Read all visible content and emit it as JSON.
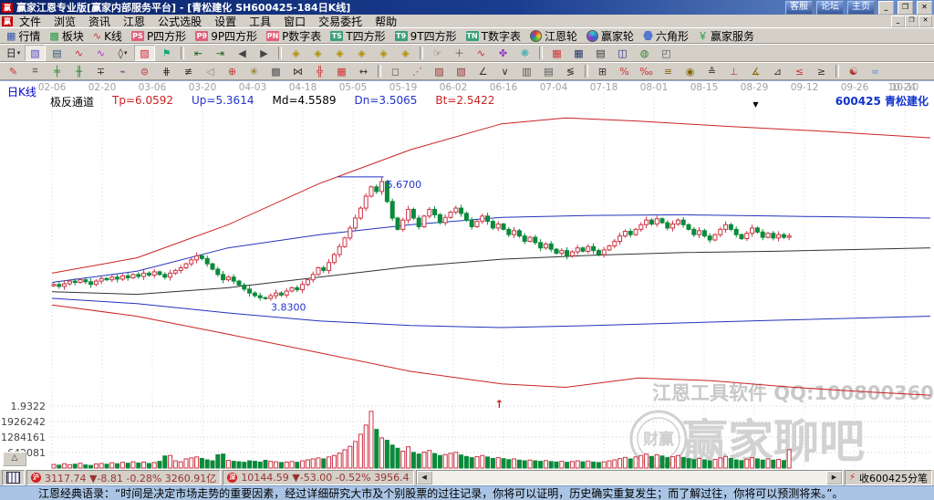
{
  "window": {
    "title": "赢家江恩专业版[赢家内部服务平台] - [青松建化  SH600425-184日K线]",
    "logo_glyph": "赢",
    "title_buttons": [
      "客服",
      "论坛",
      "主页"
    ],
    "win_controls": [
      "_",
      "❐",
      "✕"
    ]
  },
  "menu": {
    "items": [
      "文件",
      "浏览",
      "资讯",
      "江恩",
      "公式选股",
      "设置",
      "工具",
      "窗口",
      "交易委托",
      "帮助"
    ]
  },
  "toolbar_main": {
    "items": [
      {
        "icon": "grid",
        "color": "#3355aa",
        "label": "行情",
        "name": "quotes-button"
      },
      {
        "icon": "blocks",
        "color": "#2a9a4a",
        "label": "板块",
        "name": "sectors-button"
      },
      {
        "icon": "kline",
        "color": "#cc3333",
        "label": "K线",
        "name": "kline-button"
      },
      {
        "badge": "PS",
        "color": "#e0607a",
        "label": "P四方形",
        "name": "p-square-button"
      },
      {
        "badge": "P9",
        "color": "#e0607a",
        "label": "9P四方形",
        "name": "p9-square-button"
      },
      {
        "badge": "PN",
        "color": "#e0607a",
        "label": "P数字表",
        "name": "p-number-table-button"
      },
      {
        "badge": "TS",
        "color": "#3aa07a",
        "label": "T四方形",
        "name": "t-square-button"
      },
      {
        "badge": "T9",
        "color": "#3aa07a",
        "label": "9T四方形",
        "name": "t9-square-button"
      },
      {
        "badge": "TN",
        "color": "#3aa07a",
        "label": "T数字表",
        "name": "t-number-table-button"
      },
      {
        "icon": "wheel",
        "label": "江恩轮",
        "name": "gann-wheel-button"
      },
      {
        "icon": "wheel2",
        "label": "赢家轮",
        "name": "winner-wheel-button"
      },
      {
        "icon": "hex",
        "label": "六角形",
        "name": "hexagon-button"
      },
      {
        "icon": "yen",
        "color": "#2a9a4a",
        "label": "赢家服务",
        "name": "winner-service-button"
      }
    ]
  },
  "toolbar_view": {
    "items": [
      {
        "g": "日",
        "c": "#222",
        "arrow": true,
        "n": "period-day-selector"
      },
      {
        "g": "▧",
        "c": "#5548c8",
        "p": true,
        "n": "chart-style-button"
      },
      {
        "g": "▤",
        "c": "#335577",
        "n": "info-board-button"
      },
      {
        "g": "∿",
        "c": "#cc2233",
        "n": "wave-up-button"
      },
      {
        "g": "∿",
        "c": "#aa33cc",
        "n": "wave-down-button"
      },
      {
        "g": "◊",
        "c": "#333333",
        "arrow": true,
        "n": "candle-width-selector"
      },
      {
        "g": "▨",
        "c": "#cc2233",
        "p": true,
        "n": "main-chart-button"
      },
      {
        "g": "⚑",
        "c": "#11aa77",
        "n": "flag-marker-button"
      },
      {
        "sep": true
      },
      {
        "g": "⇤",
        "c": "#226622",
        "n": "first-bar-button"
      },
      {
        "g": "⇥",
        "c": "#226622",
        "n": "last-bar-button"
      },
      {
        "g": "◀",
        "c": "#444444",
        "n": "prev-bar-button"
      },
      {
        "g": "▶",
        "c": "#444444",
        "n": "next-bar-button"
      },
      {
        "sep": true
      },
      {
        "g": "◈",
        "c": "#b09000",
        "n": "zoom-out-button"
      },
      {
        "g": "◈",
        "c": "#b09000",
        "n": "zoom-in-button"
      },
      {
        "g": "◈",
        "c": "#b09000",
        "n": "expand-x-button"
      },
      {
        "g": "◈",
        "c": "#b09000",
        "n": "shrink-x-button"
      },
      {
        "g": "◈",
        "c": "#b09000",
        "n": "expand-y-button"
      },
      {
        "g": "◈",
        "c": "#b09000",
        "n": "shrink-y-button"
      },
      {
        "sep": true
      },
      {
        "g": "☞",
        "c": "#555555",
        "n": "hand-tool-button"
      },
      {
        "g": "＋",
        "c": "#555555",
        "n": "crosshair-button"
      },
      {
        "g": "∿",
        "c": "#cc2233",
        "n": "zigzag-tool-button"
      },
      {
        "g": "✤",
        "c": "#9933cc",
        "n": "seal-tool-button"
      },
      {
        "g": "❋",
        "c": "#33aaaa",
        "n": "mind-tool-button"
      },
      {
        "sep": true
      },
      {
        "g": "▦",
        "c": "#cc3333",
        "n": "calendar-button"
      },
      {
        "g": "▦",
        "c": "#223366",
        "n": "calculator-button"
      },
      {
        "g": "▤",
        "c": "#333333",
        "n": "memo-button"
      },
      {
        "g": "◫",
        "c": "#333388",
        "n": "save-button"
      },
      {
        "g": "◍",
        "c": "#338833",
        "n": "web-link-button"
      },
      {
        "g": "◰",
        "c": "#555555",
        "n": "remote-data-button"
      }
    ]
  },
  "toolbar_draw": {
    "items": [
      {
        "g": "✎",
        "c": "#cc3333",
        "n": "pen-tool"
      },
      {
        "g": "⌗",
        "c": "#333333",
        "n": "gann-square-tool"
      },
      {
        "g": "╪",
        "c": "#338833",
        "n": "time-division-tool"
      },
      {
        "g": "╫",
        "c": "#338833",
        "n": "price-division-tool"
      },
      {
        "g": "∓",
        "c": "#333333",
        "n": "offset-line-tool"
      },
      {
        "g": "⌁",
        "c": "#884488",
        "n": "wave-line-tool"
      },
      {
        "g": "⊜",
        "c": "#cc3333",
        "n": "cycle-circle-tool"
      },
      {
        "g": "⋕",
        "c": "#333333",
        "n": "grid-lines-tool"
      },
      {
        "g": "≢",
        "c": "#333333",
        "n": "n2-ruler-tool"
      },
      {
        "g": "◁",
        "c": "#888888",
        "n": "pointer-tool"
      },
      {
        "g": "⊕",
        "c": "#cc3333",
        "n": "target-circle-tool"
      },
      {
        "g": "✳",
        "c": "#886600",
        "n": "star-ray-tool"
      },
      {
        "g": "▩",
        "c": "#555555",
        "n": "shade-box-tool"
      },
      {
        "g": "⋈",
        "c": "#333333",
        "n": "cross-band-tool"
      },
      {
        "g": "╬",
        "c": "#cc3333",
        "n": "double-grid-tool"
      },
      {
        "g": "▦",
        "c": "#cc3333",
        "n": "matrix-tool"
      },
      {
        "g": "↔",
        "c": "#333333",
        "n": "horizontal-span-tool"
      },
      {
        "sep": true
      },
      {
        "g": "◻",
        "c": "#555555",
        "n": "rect-tool"
      },
      {
        "g": "⋰",
        "c": "#cc3333",
        "n": "fan-lines-tool"
      },
      {
        "g": "▨",
        "c": "#993333",
        "n": "hatch-box-tool"
      },
      {
        "g": "▧",
        "c": "#993333",
        "n": "hatch-box2-tool"
      },
      {
        "g": "∠",
        "c": "#333333",
        "n": "angle-line-tool"
      },
      {
        "g": "∨",
        "c": "#333333",
        "n": "vee-line-tool"
      },
      {
        "g": "▥",
        "c": "#555555",
        "n": "vstripe-tool"
      },
      {
        "g": "▤",
        "c": "#555555",
        "n": "hstripe-tool"
      },
      {
        "g": "≶",
        "c": "#333333",
        "n": "zig-channel-tool"
      },
      {
        "sep": true
      },
      {
        "g": "⊞",
        "c": "#333333",
        "n": "grid-box-tool"
      },
      {
        "g": "%",
        "c": "#cc3333",
        "n": "percent-tool"
      },
      {
        "g": "‰",
        "c": "#cc3333",
        "n": "permille-tool"
      },
      {
        "g": "≡",
        "c": "#886600",
        "n": "levels-tool"
      },
      {
        "g": "◉",
        "c": "#886600",
        "n": "gann-circle-tool"
      },
      {
        "g": "≙",
        "c": "#333333",
        "n": "estimate-tool"
      },
      {
        "g": "⊥",
        "c": "#cc3333",
        "n": "support-line-tool"
      },
      {
        "g": "∡",
        "c": "#886600",
        "n": "gann-angle-tool"
      },
      {
        "g": "⊿",
        "c": "#333333",
        "n": "triangle-tool"
      },
      {
        "g": "≤",
        "c": "#cc3333",
        "n": "wedge-down-tool"
      },
      {
        "g": "≥",
        "c": "#333333",
        "n": "wedge-up-tool"
      },
      {
        "sep": true
      },
      {
        "g": "☯",
        "c": "#aa3333",
        "n": "yinyang-tool"
      },
      {
        "g": "∞",
        "c": "#6688cc",
        "n": "infinity-tool"
      }
    ]
  },
  "chart_header": {
    "kline_label": "日K线",
    "stock_code": "600425",
    "stock_name": "青松建化",
    "indicator_items": [
      {
        "t": "极反通道",
        "c": "#000000"
      },
      {
        "t": "Tp=6.0592",
        "c": "#cc2222"
      },
      {
        "t": "Up=5.3614",
        "c": "#2233cc"
      },
      {
        "t": "Md=4.5589",
        "c": "#000000"
      },
      {
        "t": "Dn=3.5065",
        "c": "#2233cc"
      },
      {
        "t": "Bt=2.5422",
        "c": "#cc2222"
      }
    ]
  },
  "chart_data": {
    "type": "candlestick+volume",
    "symbol": "SH600425",
    "name": "青松建化",
    "period": "日K线 (daily)",
    "indicator": {
      "name": "极反通道",
      "Tp": 6.0592,
      "Up": 5.3614,
      "Md": 4.5589,
      "Dn": 3.5065,
      "Bt": 2.5422
    },
    "x_axis": {
      "dates": [
        "02-06",
        "02-20",
        "03-06",
        "03-20",
        "04-03",
        "04-18",
        "05-05",
        "05-19",
        "06-02",
        "06-16",
        "07-04",
        "07-18",
        "08-01",
        "08-15",
        "08-29",
        "09-12",
        "09-26",
        "10-10",
        "10-24"
      ]
    },
    "volume_axis_labels": [
      "1.9322",
      "1926242",
      "1284161",
      "642081"
    ],
    "candles": {
      "open_first": 4.03,
      "closes": [
        4.05,
        4.02,
        4.06,
        4.1,
        4.08,
        4.12,
        4.09,
        4.05,
        4.1,
        4.14,
        4.12,
        4.16,
        4.13,
        4.18,
        4.15,
        4.2,
        4.17,
        4.22,
        4.19,
        4.24,
        4.2,
        4.16,
        4.22,
        4.26,
        4.3,
        4.36,
        4.42,
        4.48,
        4.44,
        4.36,
        4.28,
        4.2,
        4.12,
        4.16,
        4.1,
        4.04,
        3.98,
        3.92,
        3.88,
        3.85,
        3.84,
        3.88,
        3.92,
        3.89,
        3.95,
        4.0,
        3.97,
        4.05,
        4.12,
        4.2,
        4.3,
        4.26,
        4.38,
        4.5,
        4.62,
        4.75,
        4.9,
        5.05,
        5.2,
        5.38,
        5.52,
        5.45,
        5.6,
        5.3,
        5.05,
        4.88,
        5.02,
        5.18,
        5.05,
        4.92,
        5.08,
        5.18,
        5.1,
        4.98,
        5.06,
        5.14,
        5.2,
        5.12,
        5.02,
        4.92,
        5.0,
        5.08,
        5.0,
        4.9,
        4.96,
        4.88,
        4.8,
        4.86,
        4.78,
        4.7,
        4.76,
        4.68,
        4.6,
        4.66,
        4.58,
        4.52,
        4.56,
        4.48,
        4.54,
        4.6,
        4.55,
        4.62,
        4.56,
        4.5,
        4.57,
        4.63,
        4.7,
        4.78,
        4.85,
        4.8,
        4.88,
        4.95,
        5.02,
        4.96,
        5.04,
        4.98,
        4.9,
        4.96,
        5.02,
        4.95,
        4.88,
        4.8,
        4.86,
        4.78,
        4.72,
        4.8,
        4.88,
        4.95,
        4.88,
        4.8,
        4.74,
        4.82,
        4.9,
        4.84,
        4.76,
        4.82,
        4.75,
        4.8,
        4.76,
        4.78
      ],
      "volumes": [
        150000,
        120000,
        180000,
        140000,
        160000,
        200000,
        130000,
        110000,
        170000,
        190000,
        160000,
        220000,
        180000,
        240000,
        200000,
        260000,
        210000,
        250000,
        190000,
        230000,
        280000,
        500000,
        520000,
        300000,
        260000,
        380000,
        420000,
        460000,
        400000,
        340000,
        300000,
        550000,
        580000,
        320000,
        280000,
        260000,
        240000,
        300000,
        280000,
        250000,
        320000,
        280000,
        260000,
        230000,
        250000,
        270000,
        240000,
        300000,
        340000,
        380000,
        420000,
        380000,
        460000,
        520000,
        620000,
        760000,
        900000,
        1100000,
        1400000,
        1780000,
        2350000,
        1600000,
        1250000,
        1150000,
        950000,
        820000,
        700000,
        880000,
        650000,
        580000,
        660000,
        730000,
        600000,
        520000,
        560000,
        610000,
        650000,
        540000,
        480000,
        430000,
        470000,
        520000,
        460000,
        400000,
        430000,
        390000,
        350000,
        380000,
        330000,
        300000,
        330000,
        300000,
        280000,
        310000,
        270000,
        250000,
        280000,
        240000,
        270000,
        300000,
        260000,
        290000,
        250000,
        230000,
        260000,
        300000,
        340000,
        390000,
        440000,
        380000,
        460000,
        520000,
        580000,
        480000,
        550000,
        500000,
        430000,
        470000,
        520000,
        440000,
        390000,
        350000,
        400000,
        340000,
        300000,
        360000,
        420000,
        480000,
        400000,
        340000,
        310000,
        370000,
        430000,
        380000,
        330000,
        380000,
        330000,
        360000,
        310000,
        760000
      ]
    },
    "price_markers": [
      {
        "index": 62,
        "price": 5.67,
        "label": "5.6700",
        "side": "above"
      },
      {
        "index": 40,
        "price": 3.83,
        "label": "3.8300",
        "side": "below"
      }
    ],
    "signals": [
      {
        "index": 84,
        "glyph": "↑",
        "color": "#cc2222"
      }
    ],
    "top_marker": {
      "index": 133,
      "glyph": "▼",
      "color": "#000000"
    },
    "channel_lines": {
      "tp": {
        "color": "#cc2222",
        "points": [
          [
            57,
            4.22
          ],
          [
            150,
            4.45
          ],
          [
            250,
            4.95
          ],
          [
            350,
            5.57
          ],
          [
            450,
            6.08
          ],
          [
            550,
            6.47
          ],
          [
            620,
            6.56
          ],
          [
            700,
            6.51
          ],
          [
            800,
            6.43
          ],
          [
            900,
            6.36
          ],
          [
            1020,
            6.26
          ]
        ]
      },
      "up": {
        "color": "#2233bb",
        "points": [
          [
            57,
            4.08
          ],
          [
            150,
            4.25
          ],
          [
            250,
            4.6
          ],
          [
            350,
            4.8
          ],
          [
            450,
            4.95
          ],
          [
            550,
            5.06
          ],
          [
            650,
            5.09
          ],
          [
            750,
            5.1
          ],
          [
            850,
            5.08
          ],
          [
            1020,
            5.05
          ]
        ]
      },
      "md": {
        "color": "#333333",
        "points": [
          [
            57,
            3.94
          ],
          [
            150,
            3.9
          ],
          [
            250,
            4.0
          ],
          [
            350,
            4.16
          ],
          [
            450,
            4.32
          ],
          [
            550,
            4.43
          ],
          [
            650,
            4.49
          ],
          [
            750,
            4.53
          ],
          [
            850,
            4.55
          ],
          [
            1020,
            4.6
          ]
        ]
      },
      "dn": {
        "color": "#2233bb",
        "points": [
          [
            57,
            3.84
          ],
          [
            150,
            3.76
          ],
          [
            250,
            3.62
          ],
          [
            350,
            3.5
          ],
          [
            450,
            3.43
          ],
          [
            550,
            3.4
          ],
          [
            650,
            3.43
          ],
          [
            750,
            3.47
          ],
          [
            850,
            3.51
          ],
          [
            1020,
            3.57
          ]
        ]
      },
      "bt": {
        "color": "#cc2222",
        "points": [
          [
            57,
            3.74
          ],
          [
            150,
            3.57
          ],
          [
            250,
            3.3
          ],
          [
            350,
            3.02
          ],
          [
            450,
            2.74
          ],
          [
            550,
            2.55
          ],
          [
            620,
            2.5
          ],
          [
            700,
            2.64
          ],
          [
            780,
            2.6
          ],
          [
            870,
            2.5
          ],
          [
            950,
            2.43
          ],
          [
            1020,
            2.38
          ]
        ]
      }
    }
  },
  "watermark": {
    "line1": "江恩工具软件  QQ:100800360",
    "brand": "赢家聊吧",
    "seal_text": "财赢"
  },
  "expand_button_glyph": "△",
  "statusbar": {
    "sh_quote": "3117.74 ▼-8.81 -0.28% 3260.91亿",
    "sz_quote": "10144.59 ▼-53.00 -0.52% 3956.4",
    "right_label": "收600425分笔",
    "scroll_left": "◀",
    "scroll_right": "▶"
  },
  "messagebar": {
    "quote": "江恩经典语录：“时间是决定市场走势的重要因素，经过详细研究大市及个别股票的过往记录，你将可以证明，历史确实重复发生；而了解过往，你将可以预测将来。”。"
  }
}
